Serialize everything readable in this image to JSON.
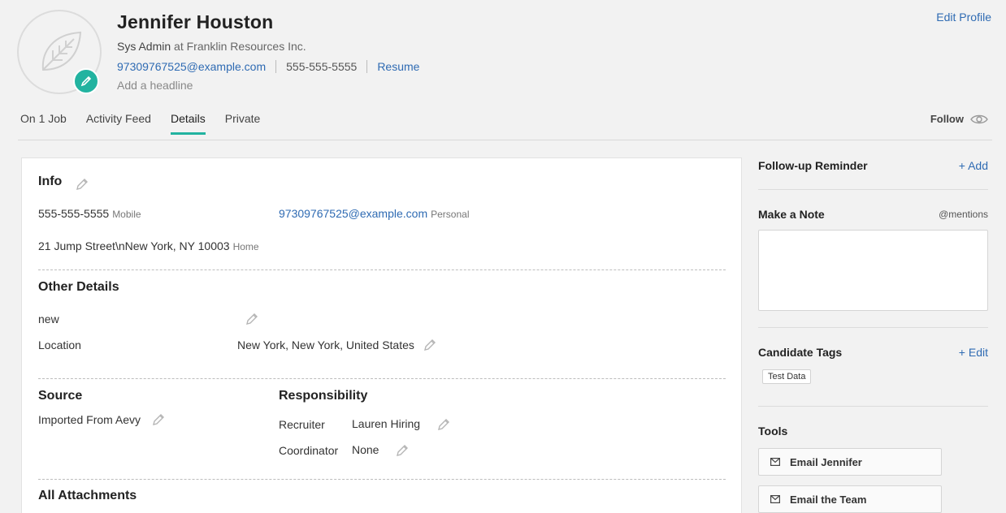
{
  "profile": {
    "name": "Jennifer Houston",
    "title": "Sys Admin",
    "at": "at",
    "company": "Franklin Resources Inc.",
    "email": "97309767525@example.com",
    "phone": "555-555-5555",
    "resume_link": "Resume",
    "headline_placeholder": "Add a headline",
    "edit_profile": "Edit Profile"
  },
  "tabs": [
    {
      "label": "On 1 Job"
    },
    {
      "label": "Activity Feed"
    },
    {
      "label": "Details",
      "active": true
    },
    {
      "label": "Private"
    }
  ],
  "follow": {
    "label": "Follow"
  },
  "info": {
    "heading": "Info",
    "phone": "555-555-5555",
    "phone_type": "Mobile",
    "email": "97309767525@example.com",
    "email_type": "Personal",
    "address": "21 Jump Street\\nNew York, NY 10003",
    "address_type": "Home"
  },
  "other_details": {
    "heading": "Other Details",
    "rows": [
      {
        "label": "new",
        "value": ""
      },
      {
        "label": "Location",
        "value": "New York, New York, United States"
      }
    ]
  },
  "source": {
    "heading": "Source",
    "value": "Imported From Aevy"
  },
  "responsibility": {
    "heading": "Responsibility",
    "recruiter_label": "Recruiter",
    "recruiter_value": "Lauren Hiring",
    "coordinator_label": "Coordinator",
    "coordinator_value": "None"
  },
  "attachments": {
    "heading": "All Attachments"
  },
  "sidebar": {
    "followup_title": "Follow-up Reminder",
    "followup_add": "+ Add",
    "note_title": "Make a Note",
    "note_mentions": "@mentions",
    "note_value": "",
    "tags_title": "Candidate Tags",
    "tags_edit": "+ Edit",
    "tags": [
      "Test Data"
    ],
    "tools_title": "Tools",
    "tools": [
      {
        "label": "Email Jennifer",
        "icon": "mail-icon"
      },
      {
        "label": "Email the Team",
        "icon": "mail-icon"
      }
    ]
  },
  "colors": {
    "accent": "#22b3a0",
    "link": "#2f6bb3",
    "background": "#f2f2f2"
  }
}
